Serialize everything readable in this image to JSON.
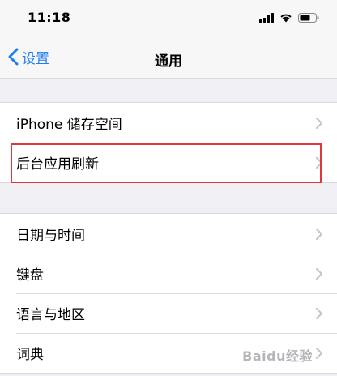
{
  "status_bar": {
    "time": "11:18"
  },
  "nav": {
    "back_label": "设置",
    "title": "通用"
  },
  "groups": [
    {
      "items": [
        {
          "label": "iPhone 储存空间"
        },
        {
          "label": "后台应用刷新"
        }
      ]
    },
    {
      "items": [
        {
          "label": "日期与时间"
        },
        {
          "label": "键盘"
        },
        {
          "label": "语言与地区"
        },
        {
          "label": "词典"
        }
      ]
    }
  ],
  "highlight_color": "#e0373b",
  "accent_color": "#1e7cf2",
  "watermark": "Baidu经验"
}
